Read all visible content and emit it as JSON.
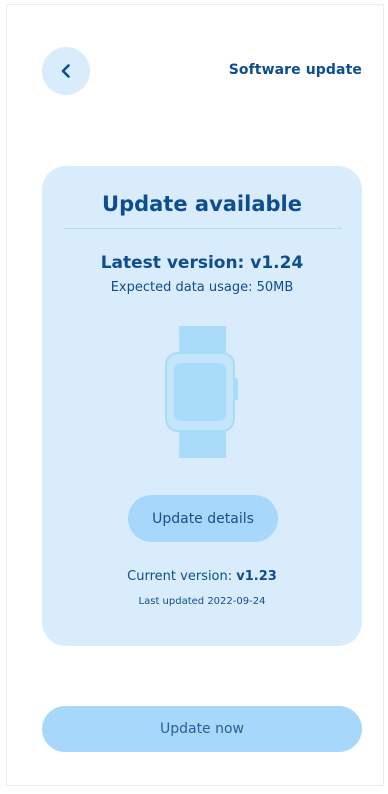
{
  "header": {
    "back_icon": "chevron-left-icon",
    "title": "Software update"
  },
  "card": {
    "title": "Update available",
    "latest_version": "Latest version: v1.24",
    "data_usage": "Expected data usage: 50MB",
    "illustration_icon": "smartwatch-icon",
    "details_button": "Update details",
    "current_version_label": "Current version:",
    "current_version_value": "v1.23",
    "last_updated": "Last updated 2022-09-24"
  },
  "footer": {
    "update_button": "Update now"
  },
  "colors": {
    "card_bg": "#d9ecfb",
    "button_bg": "#a7d8fb",
    "text_primary": "#0e4d8f",
    "divider": "#aee3ee"
  }
}
